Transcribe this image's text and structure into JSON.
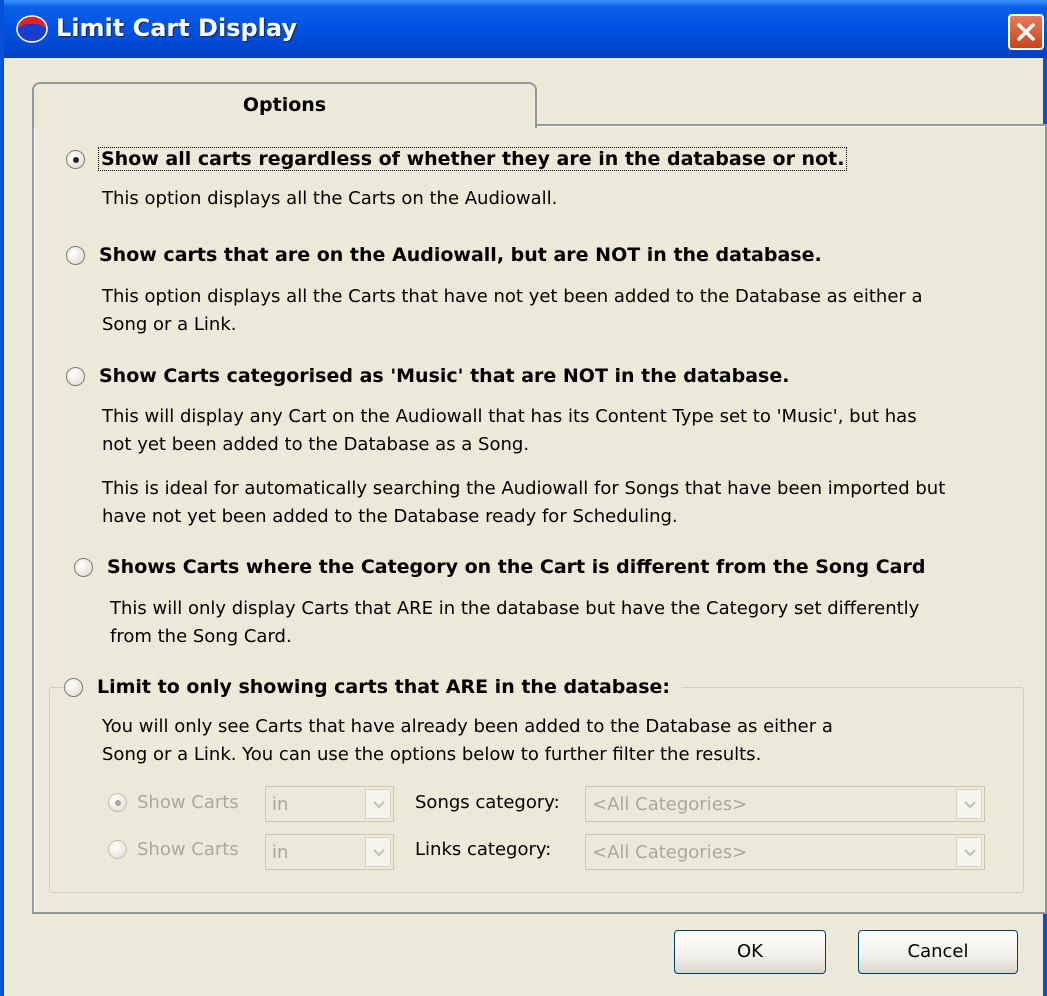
{
  "window": {
    "title": "Limit Cart Display",
    "icon": "app-icon",
    "close_icon": "close-icon"
  },
  "tab": {
    "label": "Options"
  },
  "options": [
    {
      "label": "Show all carts regardless of whether they are in the database or not.",
      "checked": true,
      "description": "This option displays all the Carts on the Audiowall."
    },
    {
      "label": "Show carts that are on the Audiowall, but are NOT in the database.",
      "checked": false,
      "description_lines": [
        "This option displays all the Carts that have not yet been added to the Database as either a",
        "Song or a Link."
      ]
    },
    {
      "label": "Show Carts categorised as 'Music' that are NOT in the database.",
      "checked": false,
      "description_lines": [
        "This will display any Cart on the Audiowall that has its Content Type set to 'Music', but has",
        "not yet been added to the Database as a Song."
      ],
      "description2_lines": [
        "This is ideal for automatically searching the Audiowall for Songs that have been imported but",
        "have not yet been added to the Database ready for Scheduling."
      ]
    },
    {
      "label": "Shows Carts where the Category on the Cart is different from the Song Card",
      "checked": false,
      "description_lines": [
        "This will only display Carts that ARE in the database but have the Category set differently",
        "from the Song Card."
      ]
    },
    {
      "label": "Limit to only showing carts that ARE in the database:",
      "checked": false,
      "description_lines": [
        "You will only see Carts that have already been added to the Database as either a",
        "Song or a Link. You can use the options below to further filter the results."
      ]
    }
  ],
  "filters": [
    {
      "radio_label": "Show Carts",
      "checked": true,
      "combo_value": "in",
      "category_label": "Songs category:",
      "category_value": "<All Categories>"
    },
    {
      "radio_label": "Show Carts",
      "checked": false,
      "combo_value": "in",
      "category_label": "Links category:",
      "category_value": "<All Categories>"
    }
  ],
  "buttons": {
    "ok": "OK",
    "cancel": "Cancel"
  },
  "colors": {
    "titlebar": "#0054e3",
    "face": "#ece9d8",
    "disabled_text": "#aca899"
  }
}
